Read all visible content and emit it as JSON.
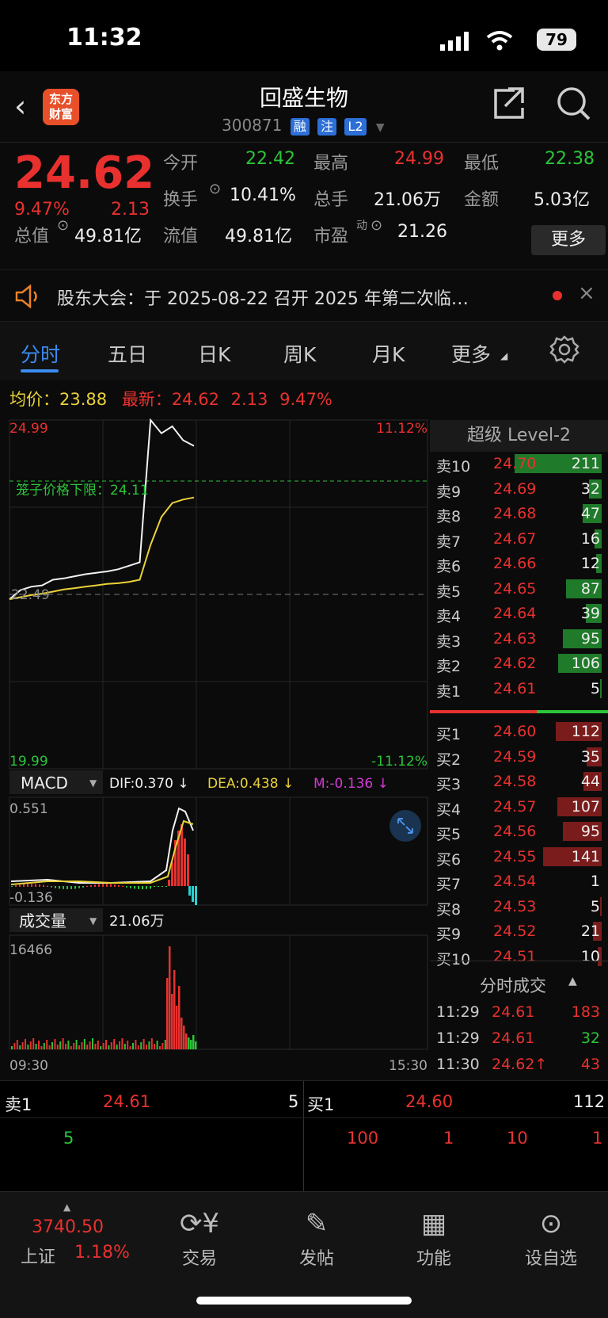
{
  "status_bar": {
    "time": "11:32",
    "battery": "79"
  },
  "header": {
    "stock_name": "回盛生物",
    "code": "300871",
    "tags": [
      "融",
      "注",
      "L2"
    ],
    "logo": "东方\n财富"
  },
  "quote": {
    "price": "24.62",
    "change_pct": "9.47%",
    "change": "2.13",
    "open_label": "今开",
    "open": "22.42",
    "high_label": "最高",
    "high": "24.99",
    "low_label": "最低",
    "low": "22.38",
    "turnover_label": "换手",
    "turnover": "10.41%",
    "volume_label": "总手",
    "volume": "21.06万",
    "amount_label": "金额",
    "amount": "5.03亿",
    "mktcap_label": "总值",
    "mktcap": "49.81亿",
    "float_label": "流值",
    "float": "49.81亿",
    "pe_label": "市盈",
    "pe_sup": "动",
    "pe": "21.26",
    "more_button": "更多"
  },
  "notice": {
    "text": "股东大会：于 2025-08-22 召开 2025 年第二次临…"
  },
  "tabs": [
    "分时",
    "五日",
    "日K",
    "周K",
    "月K",
    "更多"
  ],
  "info_line": {
    "avg_label": "均价：",
    "avg": "23.88",
    "latest_label": "最新：",
    "latest": "24.62",
    "change": "2.13",
    "pct": "9.47%"
  },
  "chart": {
    "y_top": "24.99",
    "y_bottom": "19.99",
    "pct_top": "11.12%",
    "pct_bottom": "-11.12%",
    "ref_price": "22.49",
    "band_label": "笼子价格下限：24.11",
    "time_start": "09:30",
    "time_end": "15:30",
    "macd_label": "MACD",
    "dif": "DIF:0.370 ↓",
    "dea": "DEA:0.438 ↓",
    "m": "M:-0.136 ↓",
    "macd_top": "0.551",
    "macd_bottom": "-0.136",
    "vol_label": "成交量",
    "vol_total": "21.06万",
    "vol_top": "16466"
  },
  "chart_data": {
    "type": "line",
    "title": "",
    "ylim": [
      19.99,
      24.99
    ],
    "series": [
      {
        "values": [
          22.42,
          22.55,
          22.6,
          22.62,
          22.7,
          22.72,
          22.75,
          22.78,
          22.8,
          22.82,
          22.85,
          22.9,
          22.95,
          24.99,
          24.8,
          24.9,
          24.7,
          24.62
        ]
      },
      {
        "values": [
          22.42,
          22.45,
          22.48,
          22.5,
          22.53,
          22.56,
          22.58,
          22.6,
          22.62,
          22.64,
          22.65,
          22.67,
          22.7,
          23.2,
          23.6,
          23.8,
          23.85,
          23.88
        ]
      }
    ]
  },
  "orderbook": {
    "title": "超级 Level-2",
    "asks": [
      {
        "label": "卖10",
        "price": "24.70",
        "vol": "211",
        "fill": 1.0
      },
      {
        "label": "卖9",
        "price": "24.69",
        "vol": "32",
        "fill": 0.15
      },
      {
        "label": "卖8",
        "price": "24.68",
        "vol": "47",
        "fill": 0.22
      },
      {
        "label": "卖7",
        "price": "24.67",
        "vol": "16",
        "fill": 0.08
      },
      {
        "label": "卖6",
        "price": "24.66",
        "vol": "12",
        "fill": 0.06
      },
      {
        "label": "卖5",
        "price": "24.65",
        "vol": "87",
        "fill": 0.41
      },
      {
        "label": "卖4",
        "price": "24.64",
        "vol": "39",
        "fill": 0.18
      },
      {
        "label": "卖3",
        "price": "24.63",
        "vol": "95",
        "fill": 0.45
      },
      {
        "label": "卖2",
        "price": "24.62",
        "vol": "106",
        "fill": 0.5
      },
      {
        "label": "卖1",
        "price": "24.61",
        "vol": "5",
        "fill": 0.02
      }
    ],
    "bids": [
      {
        "label": "买1",
        "price": "24.60",
        "vol": "112",
        "fill": 0.53
      },
      {
        "label": "买2",
        "price": "24.59",
        "vol": "35",
        "fill": 0.17
      },
      {
        "label": "买3",
        "price": "24.58",
        "vol": "44",
        "fill": 0.21
      },
      {
        "label": "买4",
        "price": "24.57",
        "vol": "107",
        "fill": 0.51
      },
      {
        "label": "买5",
        "price": "24.56",
        "vol": "95",
        "fill": 0.45
      },
      {
        "label": "买6",
        "price": "24.55",
        "vol": "141",
        "fill": 0.67
      },
      {
        "label": "买7",
        "price": "24.54",
        "vol": "1",
        "fill": 0.0
      },
      {
        "label": "买8",
        "price": "24.53",
        "vol": "5",
        "fill": 0.02
      },
      {
        "label": "买9",
        "price": "24.52",
        "vol": "21",
        "fill": 0.1
      },
      {
        "label": "买10",
        "price": "24.51",
        "vol": "10",
        "fill": 0.05
      }
    ],
    "ticks_title": "分时成交",
    "ticks": [
      {
        "time": "11:29",
        "price": "24.61",
        "vol": "183",
        "color": "red"
      },
      {
        "time": "11:29",
        "price": "24.61",
        "vol": "32",
        "color": "green"
      },
      {
        "time": "11:30",
        "price": "24.62↑",
        "vol": "43",
        "color": "red"
      }
    ]
  },
  "level1": {
    "ask_label": "卖1",
    "ask_price": "24.61",
    "ask_vol": "5",
    "bid_label": "买1",
    "bid_price": "24.60",
    "bid_vol": "112",
    "left_queue": [
      "5"
    ],
    "right_queue": [
      "100",
      "1",
      "10",
      "1"
    ]
  },
  "footer": {
    "index_value": "3740.50",
    "index_name": "上证",
    "index_pct": "1.18%",
    "items": [
      {
        "label": "交易",
        "icon": "yen-icon"
      },
      {
        "label": "发帖",
        "icon": "edit-icon"
      },
      {
        "label": "功能",
        "icon": "grid-icon"
      },
      {
        "label": "设自选",
        "icon": "more-icon"
      }
    ]
  }
}
